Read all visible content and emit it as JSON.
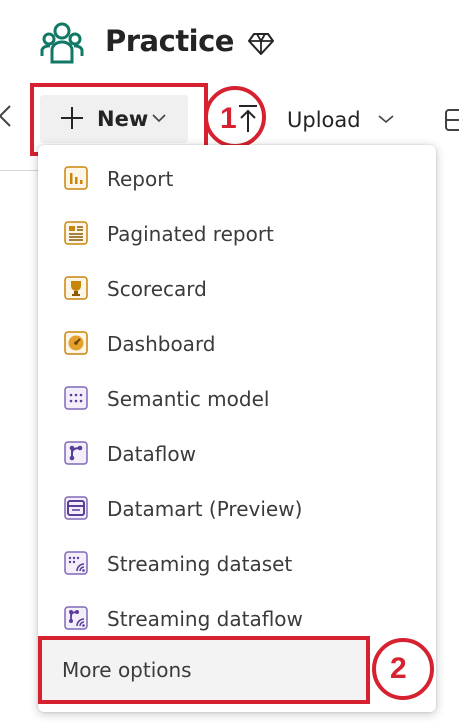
{
  "workspace": {
    "title": "Practice",
    "icon": "workspace-people-icon",
    "premium_icon": "diamond-icon"
  },
  "toolbar": {
    "new_label": "New",
    "upload_label": "Upload",
    "icons": [
      "plus-icon",
      "chevron-down-icon",
      "upload-arrow-icon",
      "collapse-icon"
    ]
  },
  "callouts": [
    {
      "number": "1"
    },
    {
      "number": "2"
    }
  ],
  "new_menu": {
    "items": [
      {
        "label": "Report",
        "icon": "report-icon"
      },
      {
        "label": "Paginated report",
        "icon": "paginated-report-icon"
      },
      {
        "label": "Scorecard",
        "icon": "scorecard-trophy-icon"
      },
      {
        "label": "Dashboard",
        "icon": "dashboard-gauge-icon"
      },
      {
        "label": "Semantic model",
        "icon": "semantic-model-icon"
      },
      {
        "label": "Dataflow",
        "icon": "dataflow-icon"
      },
      {
        "label": "Datamart (Preview)",
        "icon": "datamart-icon"
      },
      {
        "label": "Streaming dataset",
        "icon": "streaming-dataset-icon"
      },
      {
        "label": "Streaming dataflow",
        "icon": "streaming-dataflow-icon"
      }
    ],
    "more_options_label": "More options"
  },
  "colors": {
    "callout_red": "#d62230",
    "accent_teal": "#117865",
    "report_gold": "#c8860a",
    "dataflow_purple": "#5b3d9a"
  }
}
